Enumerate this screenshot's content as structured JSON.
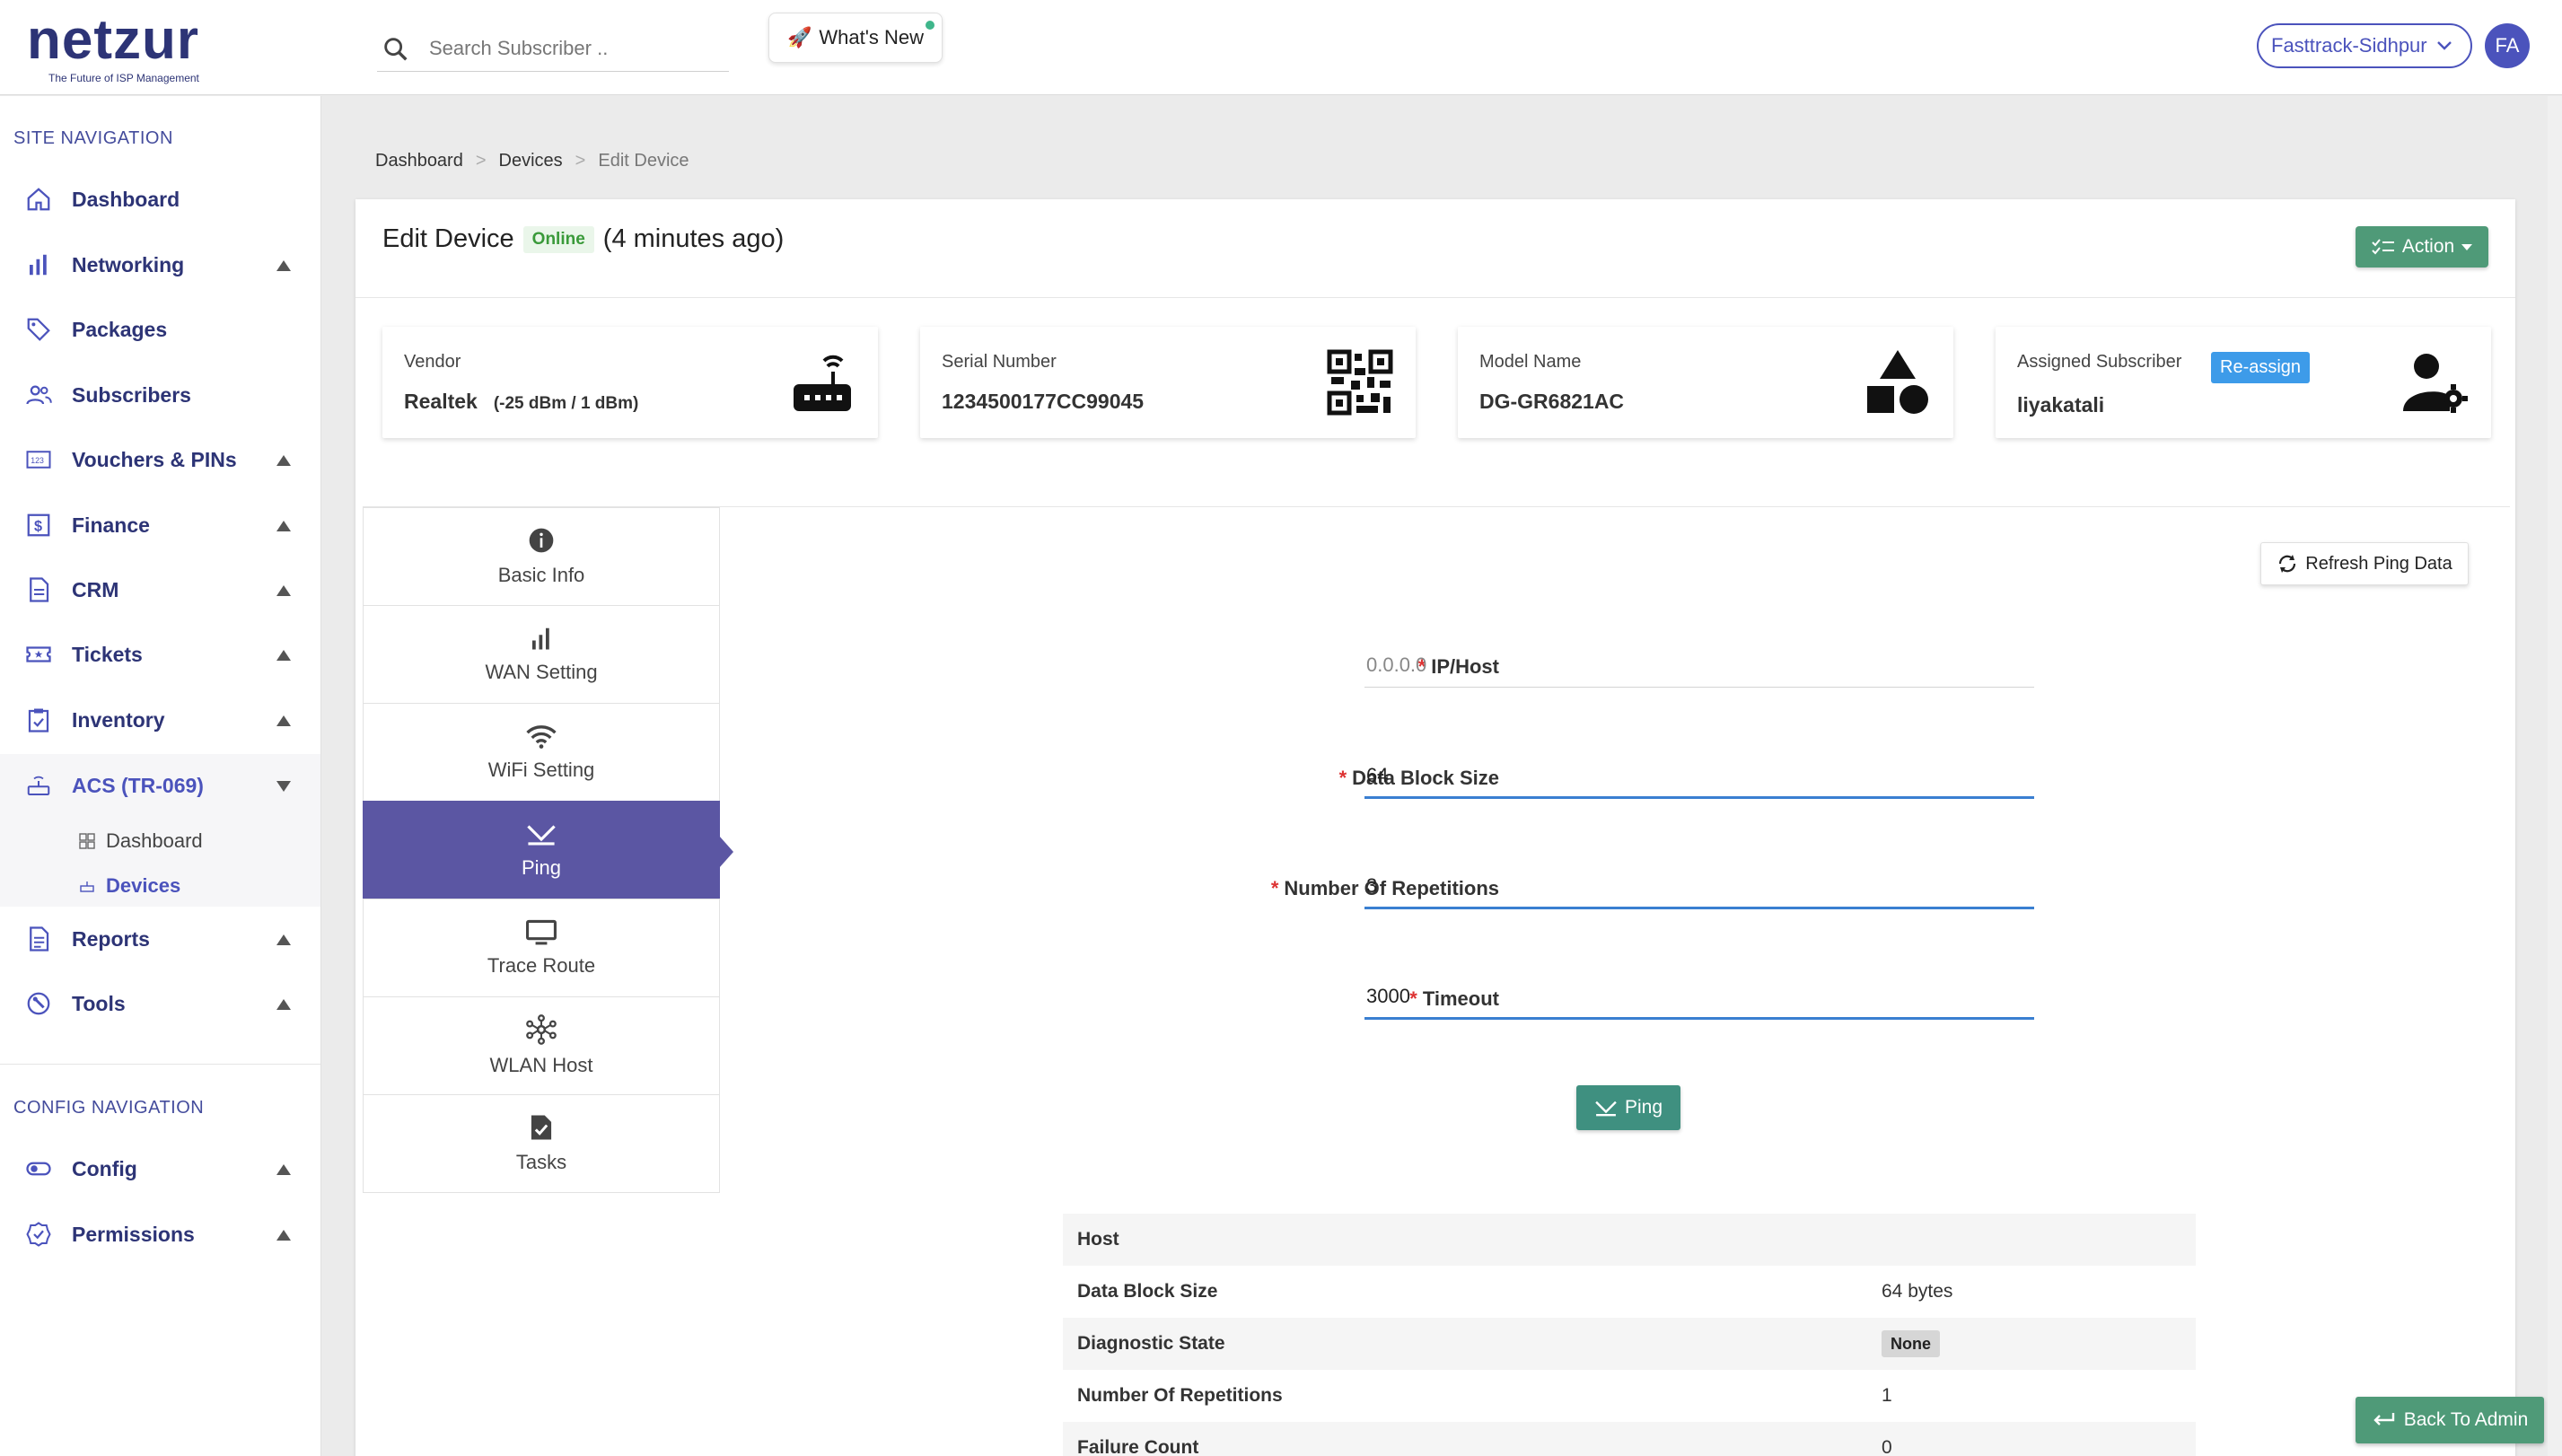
{
  "header": {
    "logo_word": "netzur",
    "logo_tagline": "The Future of ISP Management",
    "search_placeholder": "Search Subscriber ..",
    "whats_new": "What's New",
    "tenant": "Fasttrack-Sidhpur",
    "avatar_initials": "FA"
  },
  "sidebar": {
    "site_title": "SITE NAVIGATION",
    "config_title": "CONFIG NAVIGATION",
    "items": [
      {
        "label": "Dashboard",
        "icon": "home-icon"
      },
      {
        "label": "Networking",
        "icon": "bar-chart-icon"
      },
      {
        "label": "Packages",
        "icon": "tag-icon"
      },
      {
        "label": "Subscribers",
        "icon": "users-icon"
      },
      {
        "label": "Vouchers & PINs",
        "icon": "voucher-icon"
      },
      {
        "label": "Finance",
        "icon": "dollar-icon"
      },
      {
        "label": "CRM",
        "icon": "document-icon"
      },
      {
        "label": "Tickets",
        "icon": "ticket-icon"
      },
      {
        "label": "Inventory",
        "icon": "clipboard-icon"
      },
      {
        "label": "ACS (TR-069)",
        "icon": "router-icon"
      },
      {
        "label": "Reports",
        "icon": "report-icon"
      },
      {
        "label": "Tools",
        "icon": "wrench-icon"
      }
    ],
    "acs_sub": [
      {
        "label": "Dashboard"
      },
      {
        "label": "Devices"
      }
    ],
    "config_items": [
      {
        "label": "Config",
        "icon": "toggle-icon"
      },
      {
        "label": "Permissions",
        "icon": "badge-check-icon"
      }
    ]
  },
  "breadcrumb": [
    "Dashboard",
    "Devices",
    "Edit Device"
  ],
  "breadcrumb_sep": ">",
  "device": {
    "title": "Edit Device",
    "status": "Online",
    "last_seen": "(4 minutes ago)",
    "action_label": "Action",
    "vendor_label": "Vendor",
    "vendor": "Realtek",
    "signal": "(-25 dBm / 1 dBm)",
    "serial_label": "Serial Number",
    "serial": "1234500177CC99045",
    "model_label": "Model Name",
    "model": "DG-GR6821AC",
    "subscriber_label": "Assigned Subscriber",
    "subscriber": "liyakatali",
    "reassign": "Re-assign"
  },
  "tabs": [
    {
      "label": "Basic Info",
      "icon": "info-icon"
    },
    {
      "label": "WAN Setting",
      "icon": "signal-bars-icon"
    },
    {
      "label": "WiFi Setting",
      "icon": "wifi-icon"
    },
    {
      "label": "Ping",
      "icon": "ping-icon",
      "active": true
    },
    {
      "label": "Trace Route",
      "icon": "monitor-icon"
    },
    {
      "label": "WLAN Host",
      "icon": "network-hub-icon"
    },
    {
      "label": "Tasks",
      "icon": "task-icon"
    }
  ],
  "ping": {
    "refresh_label": "Refresh Ping Data",
    "fields": [
      {
        "label": "IP/Host",
        "value": "",
        "placeholder": "0.0.0.0"
      },
      {
        "label": "Data Block Size",
        "value": "64"
      },
      {
        "label": "Number Of Repetitions",
        "value": "3"
      },
      {
        "label": "Timeout",
        "value": "3000"
      }
    ],
    "submit_label": "Ping",
    "results": [
      {
        "key": "Host",
        "value": ""
      },
      {
        "key": "Data Block Size",
        "value": "64 bytes"
      },
      {
        "key": "Diagnostic State",
        "value": "None"
      },
      {
        "key": "Number Of Repetitions",
        "value": "1"
      },
      {
        "key": "Failure Count",
        "value": "0"
      }
    ]
  },
  "back_to_admin": "Back To Admin",
  "colors": {
    "brand": "#2d3476",
    "accent": "#4b53bc",
    "active_tab": "#5b56a3",
    "action_green": "#4f9a78",
    "online_green": "#3a9a3a"
  }
}
